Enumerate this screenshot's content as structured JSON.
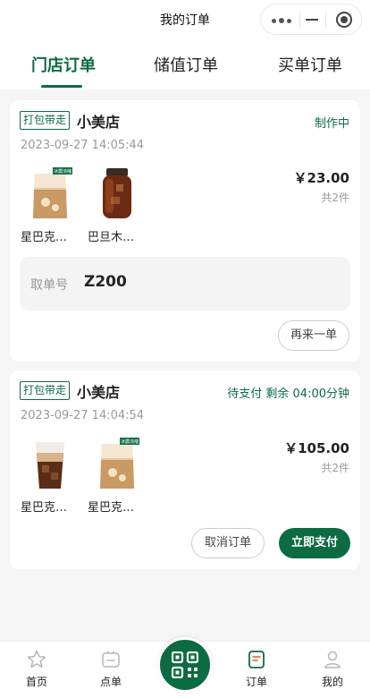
{
  "header": {
    "title": "我的订单"
  },
  "tabs": [
    "门店订单",
    "储值订单",
    "买单订单"
  ],
  "active_tab": "门店订单",
  "orders": [
    {
      "type_badge": "打包带走",
      "store": "小美店",
      "status": "制作中",
      "time": "2023-09-27 14:05:44",
      "items": [
        {
          "name": "星巴克…",
          "tag": "冰震浓缩",
          "icon": "iced-latte-bag-icon"
        },
        {
          "name": "巴旦木…",
          "tag": "",
          "icon": "cold-brew-jar-icon"
        }
      ],
      "price": "￥23.00",
      "count": "共2件",
      "pickup_label": "取单号",
      "pickup_code": "Z200",
      "actions": [
        "再来一单"
      ]
    },
    {
      "type_badge": "打包带走",
      "store": "小美店",
      "status": "待支付 剩余 04:00分钟",
      "time": "2023-09-27 14:04:54",
      "items": [
        {
          "name": "星巴克…",
          "tag": "",
          "icon": "iced-coffee-cup-icon"
        },
        {
          "name": "星巴克…",
          "tag": "冰震浓缩",
          "icon": "iced-latte-bag-icon"
        }
      ],
      "price": "￥105.00",
      "count": "共2件",
      "actions": [
        "取消订单",
        "立即支付"
      ]
    }
  ],
  "tabbar": [
    {
      "label": "首页",
      "icon": "star-icon"
    },
    {
      "label": "点单",
      "icon": "order-menu-icon"
    },
    {
      "label": "",
      "icon": "qr-code-icon"
    },
    {
      "label": "订单",
      "icon": "order-list-icon"
    },
    {
      "label": "我的",
      "icon": "user-icon"
    }
  ],
  "colors": {
    "brand": "#0d6b43",
    "background": "#f5f5f5",
    "muted": "#999999"
  }
}
